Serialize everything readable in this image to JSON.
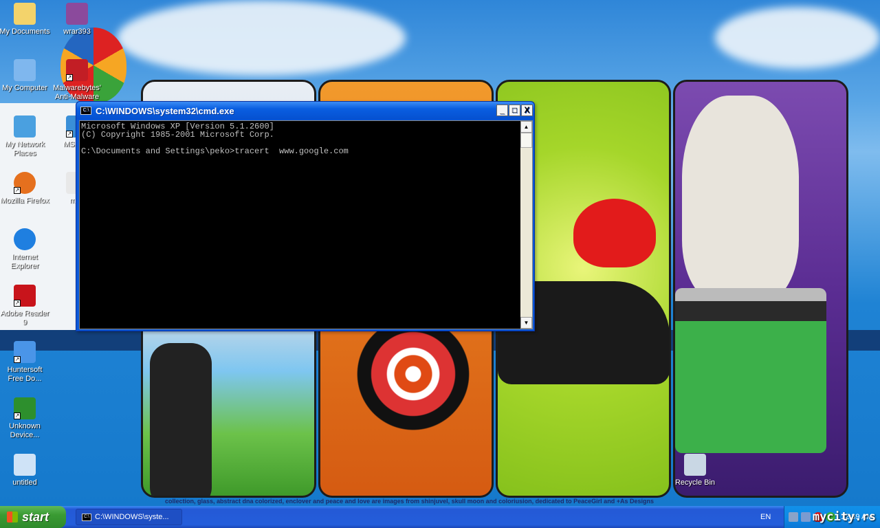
{
  "desktop": {
    "icons": [
      {
        "label": "My Documents",
        "icon": "my-documents-icon",
        "color": "#f3d36b"
      },
      {
        "label": "wrar393",
        "icon": "winrar-icon",
        "color": "#8b4a9c"
      },
      {
        "label": "My Computer",
        "icon": "my-computer-icon",
        "color": "#7fb7ee"
      },
      {
        "label": "Malwarebytes' Anti-Malware",
        "icon": "malwarebytes-icon",
        "color": "#c21e25"
      },
      {
        "label": "My Network Places",
        "icon": "network-places-icon",
        "color": "#4aa0e0"
      },
      {
        "label": "MSN I...",
        "icon": "msn-icon",
        "color": "#3a8fd8"
      },
      {
        "label": "Mozilla Firefox",
        "icon": "firefox-icon",
        "color": "#e5701e"
      },
      {
        "label": "mi...",
        "icon": "document-icon",
        "color": "#e8e8e8"
      },
      {
        "label": "Internet Explorer",
        "icon": "internet-explorer-icon",
        "color": "#1f7fe0"
      },
      {
        "label": "Adobe Reader 9",
        "icon": "adobe-reader-icon",
        "color": "#c8141b"
      },
      {
        "label": "Huntersoft Free Do...",
        "icon": "huntersoft-icon",
        "color": "#4a95e8"
      },
      {
        "label": "Unknown Device...",
        "icon": "device-icon",
        "color": "#2d8f2d"
      },
      {
        "label": "untitled",
        "icon": "paint-file-icon",
        "color": "#cfe3f7"
      },
      {
        "label": "Recycle Bin",
        "icon": "recycle-bin-icon",
        "color": "#c9d7e4"
      }
    ],
    "wallpaper_credits": "collection, glass, abstract dna colorized, enclover and peace and love are images from shinjuvel, skull moon and coloriusion, dedicated to PeaceGirl and +As Designs",
    "watermark": "mycity.rs"
  },
  "cmd_window": {
    "title": "C:\\WINDOWS\\system32\\cmd.exe",
    "icon_text": "C:\\",
    "minimize": "_",
    "maximize": "□",
    "close": "X",
    "output": "Microsoft Windows XP [Version 5.1.2600]\n(C) Copyright 1985-2001 Microsoft Corp.\n\nC:\\Documents and Settings\\peko>tracert  www.google.com",
    "scroll_up": "▲",
    "scroll_down": "▼"
  },
  "taskbar": {
    "start_label": "start",
    "tasks": [
      {
        "label": "C:\\WINDOWS\\syste..."
      }
    ],
    "language": "EN",
    "clock": "12:39 AM",
    "tray_icons": [
      "network-disconnected-icon",
      "network-icon",
      "security-alert-icon",
      "green-status-icon"
    ]
  }
}
